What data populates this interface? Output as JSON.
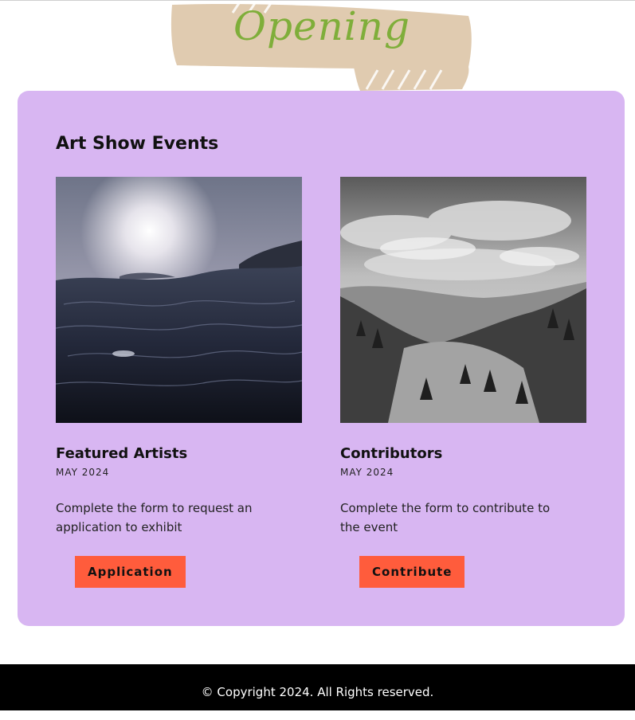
{
  "banner": {
    "text": "Opening"
  },
  "section": {
    "title": "Art Show Events"
  },
  "events": [
    {
      "title": "Featured Artists",
      "date": "MAY 2024",
      "description": "Complete the form to request an application to exhibit",
      "button_label": "Application",
      "image": "ocean-sunset-photo"
    },
    {
      "title": "Contributors",
      "date": "MAY 2024",
      "description": "Complete the form to contribute to the event",
      "button_label": "Contribute",
      "image": "mountain-forest-bw-photo"
    }
  ],
  "footer": {
    "text": "© Copyright 2024. All Rights reserved."
  },
  "colors": {
    "card_bg": "#d8b6f2",
    "button_bg": "#ff5c3c",
    "banner_bg": "#e0cbb0",
    "banner_text": "#7fae3a",
    "footer_bg": "#000000"
  }
}
